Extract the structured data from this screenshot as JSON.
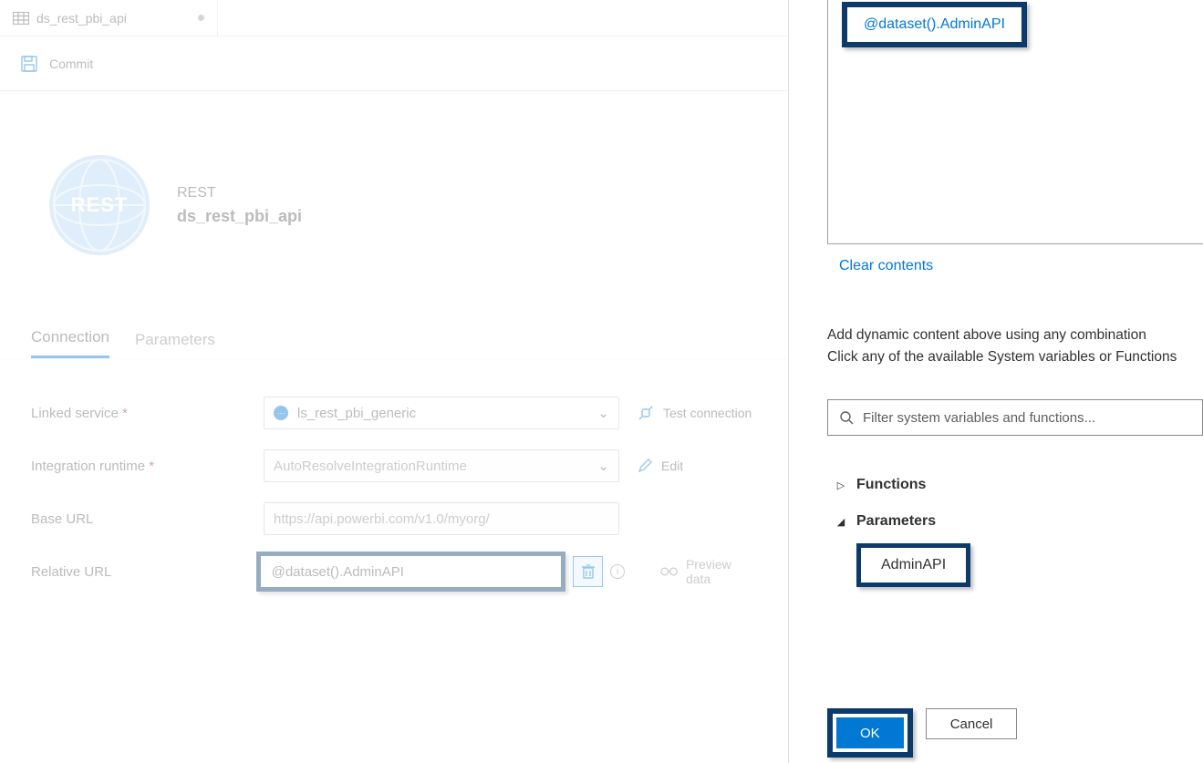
{
  "tab": {
    "title": "ds_rest_pbi_api"
  },
  "toolbar": {
    "commit": "Commit"
  },
  "header": {
    "type": "REST",
    "name": "ds_rest_pbi_api",
    "badge": "REST"
  },
  "subtabs": {
    "connection": "Connection",
    "parameters": "Parameters"
  },
  "form": {
    "linkedServiceLabel": "Linked service",
    "linkedServiceValue": "ls_rest_pbi_generic",
    "testConnection": "Test connection",
    "integrationRuntimeLabel": "Integration runtime",
    "integrationRuntimeValue": "AutoResolveIntegrationRuntime",
    "editLabel": "Edit",
    "baseUrlLabel": "Base URL",
    "baseUrlValue": "https://api.powerbi.com/v1.0/myorg/",
    "relativeUrlLabel": "Relative URL",
    "relativeUrlValue": "@dataset().AdminAPI",
    "previewData": "Preview data"
  },
  "panel": {
    "expression": "@dataset().AdminAPI",
    "clearContents": "Clear contents",
    "help1": "Add dynamic content above using any combination",
    "help2": "Click any of the available System variables or Functions",
    "filterPlaceholder": "Filter system variables and functions...",
    "functionsLabel": "Functions",
    "parametersLabel": "Parameters",
    "paramItem": "AdminAPI",
    "ok": "OK",
    "cancel": "Cancel"
  }
}
